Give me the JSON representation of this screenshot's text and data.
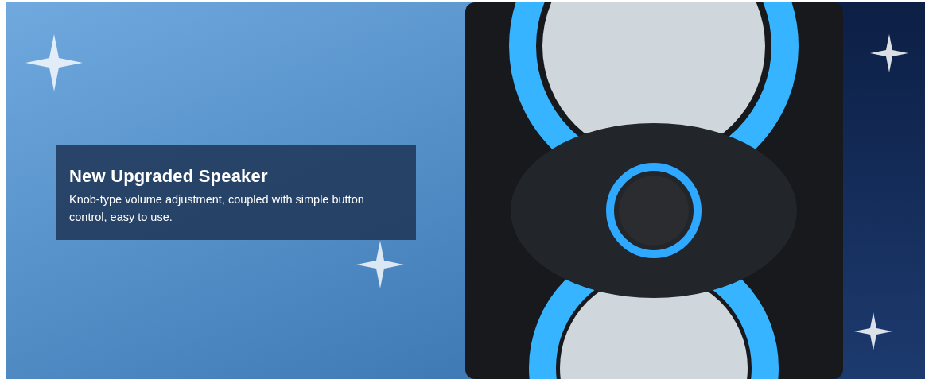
{
  "banner": {
    "overlay": {
      "title": "New Upgraded Speaker",
      "text": "Knob-type volume adjustment, coupled with simple button control, easy to use."
    }
  }
}
